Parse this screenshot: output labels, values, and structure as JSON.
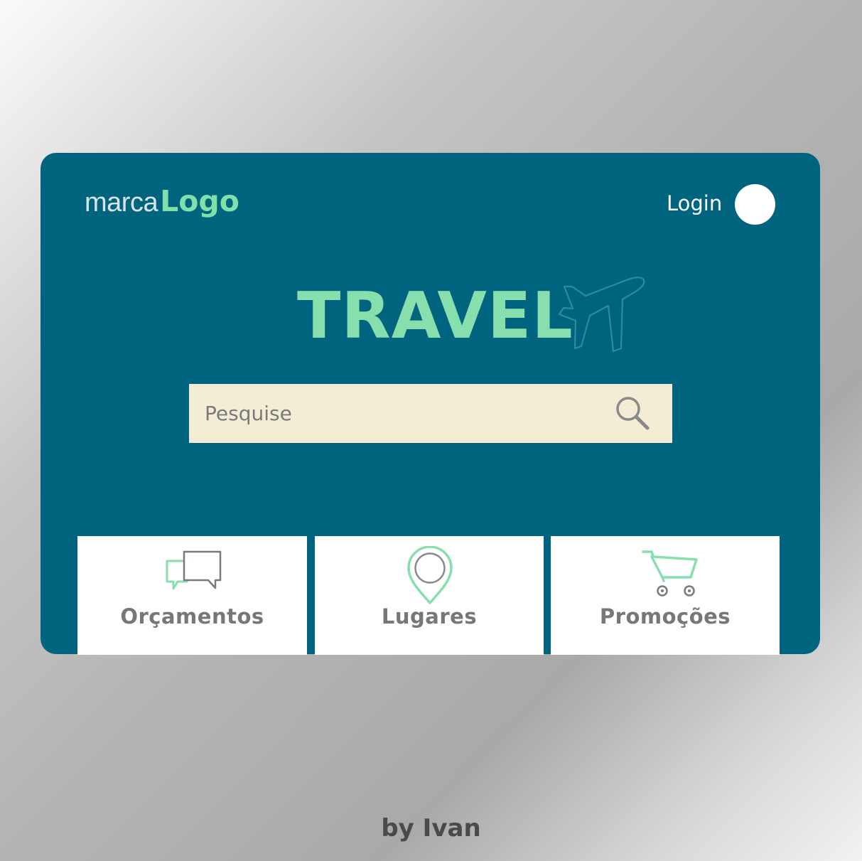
{
  "brand": {
    "prefix": "marca",
    "name": "Logo"
  },
  "header": {
    "login_label": "Login",
    "avatar_icon": "user-avatar-circle"
  },
  "hero": {
    "title": "TRAVEL",
    "decoration_icon": "airplane-icon"
  },
  "search": {
    "placeholder": "Pesquise",
    "value": "",
    "icon": "search-icon"
  },
  "categories": [
    {
      "label": "Orçamentos",
      "icon": "chat-bubbles-icon"
    },
    {
      "label": "Lugares",
      "icon": "location-pin-icon"
    },
    {
      "label": "Promoções",
      "icon": "shopping-cart-icon"
    }
  ],
  "footer": {
    "credit": "by Ivan"
  },
  "colors": {
    "card_background": "#00647e",
    "accent_green": "#86dfad",
    "search_background": "#f3edd6",
    "tile_label": "#777777"
  }
}
